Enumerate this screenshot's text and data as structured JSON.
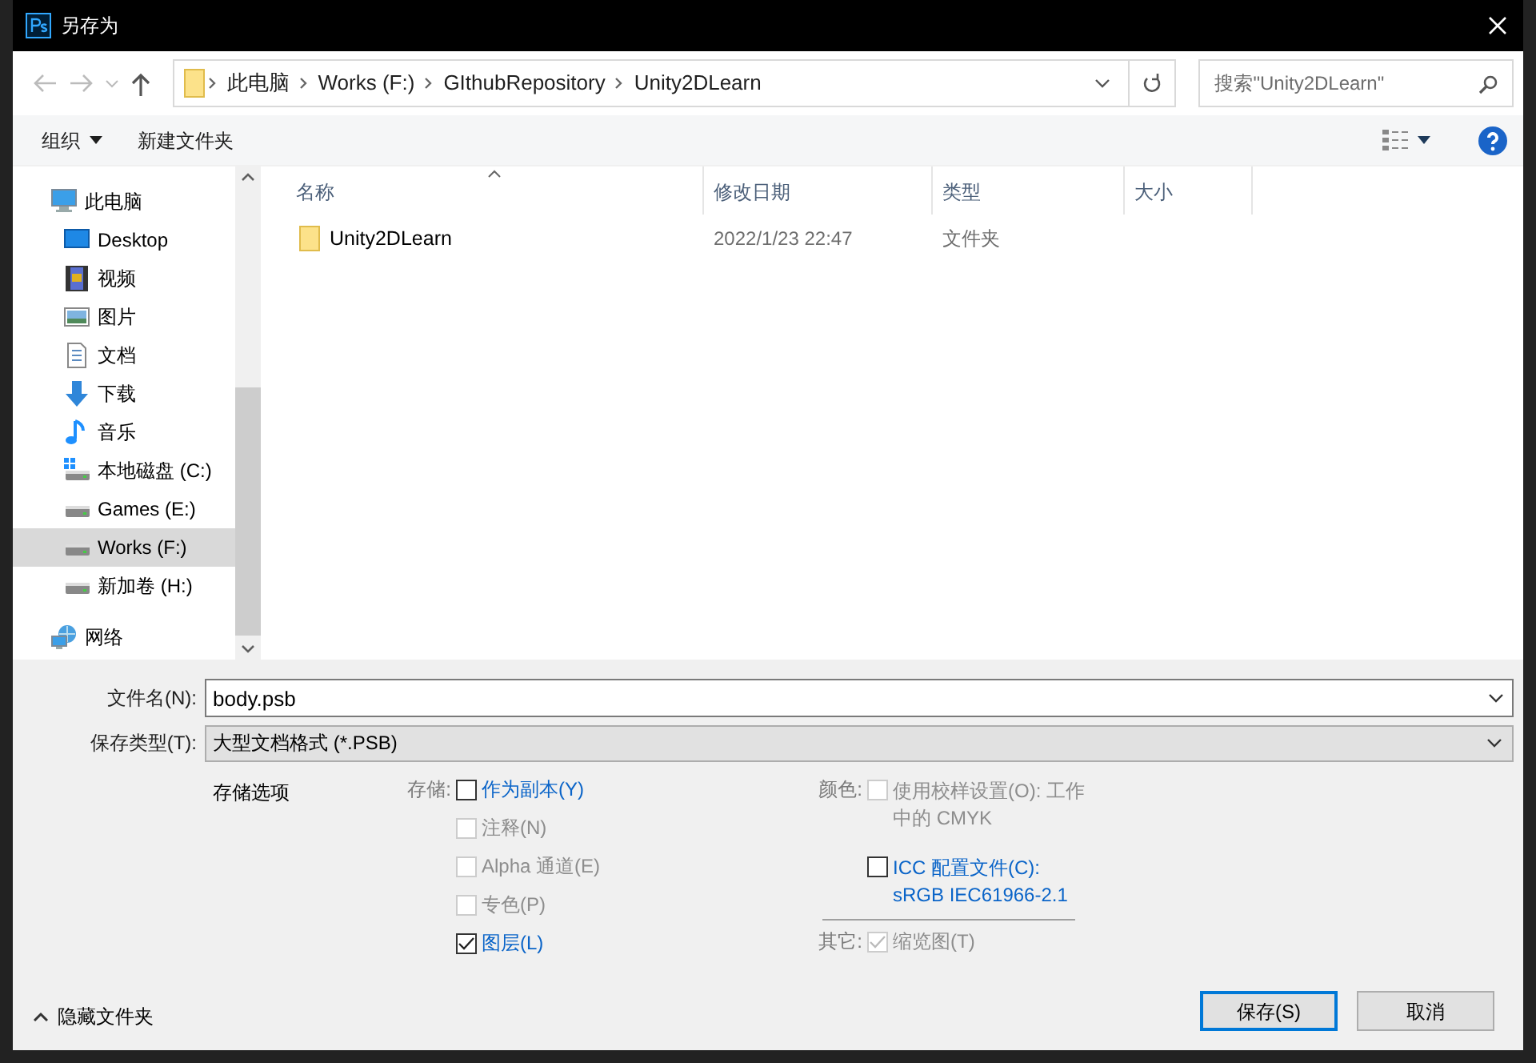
{
  "window": {
    "title": "另存为"
  },
  "breadcrumb": [
    "此电脑",
    "Works (F:)",
    "GIthubRepository",
    "Unity2DLearn"
  ],
  "search": {
    "placeholder": "搜索\"Unity2DLearn\""
  },
  "toolbar": {
    "organize": "组织",
    "new_folder": "新建文件夹"
  },
  "sidebar": {
    "items": [
      {
        "label": "此电脑",
        "kind": "computer",
        "selected": false,
        "children": [
          {
            "label": "Desktop",
            "kind": "desktop",
            "selected": false
          },
          {
            "label": "视频",
            "kind": "video",
            "selected": false
          },
          {
            "label": "图片",
            "kind": "pictures",
            "selected": false
          },
          {
            "label": "文档",
            "kind": "documents",
            "selected": false
          },
          {
            "label": "下载",
            "kind": "downloads",
            "selected": false
          },
          {
            "label": "音乐",
            "kind": "music",
            "selected": false
          },
          {
            "label": "本地磁盘 (C:)",
            "kind": "system-drive",
            "selected": false
          },
          {
            "label": "Games (E:)",
            "kind": "drive",
            "selected": false
          },
          {
            "label": "Works (F:)",
            "kind": "drive",
            "selected": true
          },
          {
            "label": "新加卷 (H:)",
            "kind": "drive",
            "selected": false
          }
        ]
      },
      {
        "label": "网络",
        "kind": "network",
        "selected": false
      }
    ]
  },
  "file_list": {
    "columns": [
      "名称",
      "修改日期",
      "类型",
      "大小"
    ],
    "rows": [
      {
        "name": "Unity2DLearn",
        "modified": "2022/1/23 22:47",
        "type": "文件夹"
      }
    ]
  },
  "form": {
    "file_name": {
      "label": "文件名(N):",
      "value": "body.psb"
    },
    "file_type": {
      "label": "保存类型(T):",
      "value": "大型文档格式 (*.PSB)"
    }
  },
  "save_options": {
    "title": "存储选项",
    "storage": {
      "label": "存储:",
      "options": [
        {
          "label": "作为副本(Y)",
          "checked": false,
          "disabled": false
        },
        {
          "label": "注释(N)",
          "checked": false,
          "disabled": true
        },
        {
          "label": "Alpha 通道(E)",
          "checked": false,
          "disabled": true
        },
        {
          "label": "专色(P)",
          "checked": false,
          "disabled": true
        },
        {
          "label": "图层(L)",
          "checked": true,
          "disabled": false
        }
      ]
    },
    "color": {
      "label": "颜色:",
      "options": [
        {
          "label": "使用校样设置(O):  工作中的 CMYK",
          "checked": false,
          "disabled": true
        },
        {
          "label": "ICC 配置文件(C): sRGB IEC61966-2.1",
          "checked": false,
          "disabled": false
        }
      ]
    },
    "other": {
      "label": "其它:",
      "options": [
        {
          "label": "缩览图(T)",
          "checked": true,
          "disabled": true
        }
      ]
    }
  },
  "hide_folders": "隐藏文件夹",
  "buttons": [
    {
      "label": "保存(S)",
      "default": true
    },
    {
      "label": "取消",
      "default": false
    }
  ]
}
